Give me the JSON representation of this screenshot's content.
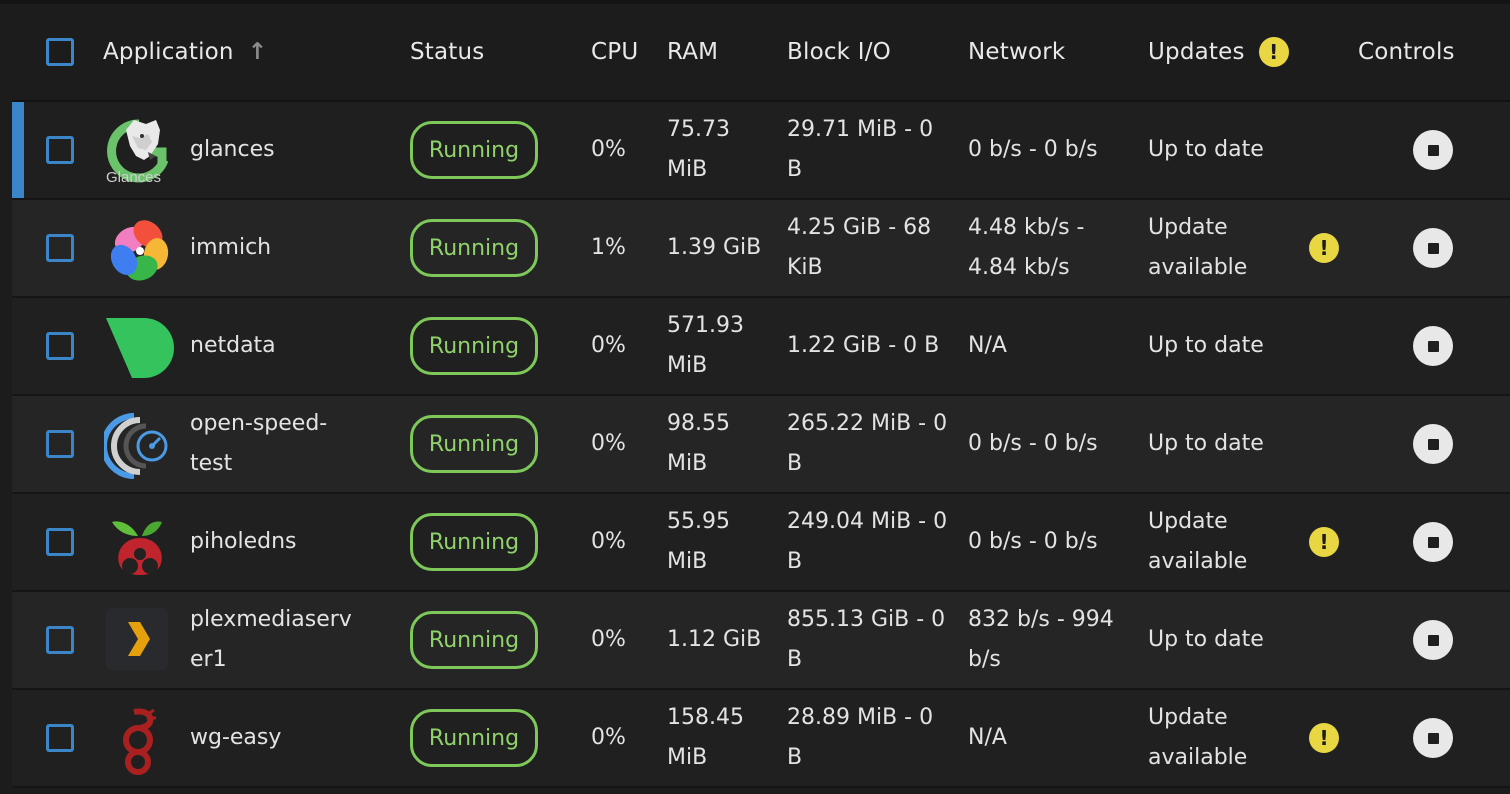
{
  "header": {
    "application": "Application",
    "sort_arrow": "↑",
    "status": "Status",
    "cpu": "CPU",
    "ram": "RAM",
    "block_io": "Block I/O",
    "network": "Network",
    "updates": "Updates",
    "updates_warn": "!",
    "controls": "Controls"
  },
  "colors": {
    "accent": "#3a86c8",
    "running": "#7ec85a",
    "warning": "#e8d642"
  },
  "rows": [
    {
      "name": "glances",
      "name_l1": "glances",
      "name_l2": "",
      "icon": "glances-icon",
      "logo_caption": "Glances",
      "status": "Running",
      "cpu": "0%",
      "ram_l1": "75.73",
      "ram_l2": "MiB",
      "bio_l1": "29.71 MiB - 0",
      "bio_l2": "B",
      "net_l1": "0 b/s - 0 b/s",
      "net_l2": "",
      "upd_l1": "Up to date",
      "upd_l2": "",
      "update_available": false
    },
    {
      "name": "immich",
      "name_l1": "immich",
      "name_l2": "",
      "icon": "immich-icon",
      "status": "Running",
      "cpu": "1%",
      "ram_l1": "1.39 GiB",
      "ram_l2": "",
      "bio_l1": "4.25 GiB - 68",
      "bio_l2": "KiB",
      "net_l1": "4.48 kb/s -",
      "net_l2": "4.84 kb/s",
      "upd_l1": "Update",
      "upd_l2": "available",
      "update_available": true
    },
    {
      "name": "netdata",
      "name_l1": "netdata",
      "name_l2": "",
      "icon": "netdata-icon",
      "status": "Running",
      "cpu": "0%",
      "ram_l1": "571.93",
      "ram_l2": "MiB",
      "bio_l1": "1.22 GiB - 0 B",
      "bio_l2": "",
      "net_l1": "N/A",
      "net_l2": "",
      "upd_l1": "Up to date",
      "upd_l2": "",
      "update_available": false
    },
    {
      "name": "open-speed-test",
      "name_l1": "open-speed-",
      "name_l2": "test",
      "icon": "speedtest-icon",
      "status": "Running",
      "cpu": "0%",
      "ram_l1": "98.55",
      "ram_l2": "MiB",
      "bio_l1": "265.22 MiB - 0",
      "bio_l2": "B",
      "net_l1": "0 b/s - 0 b/s",
      "net_l2": "",
      "upd_l1": "Up to date",
      "upd_l2": "",
      "update_available": false
    },
    {
      "name": "piholedns",
      "name_l1": "piholedns",
      "name_l2": "",
      "icon": "pihole-icon",
      "status": "Running",
      "cpu": "0%",
      "ram_l1": "55.95",
      "ram_l2": "MiB",
      "bio_l1": "249.04 MiB - 0",
      "bio_l2": "B",
      "net_l1": "0 b/s - 0 b/s",
      "net_l2": "",
      "upd_l1": "Update",
      "upd_l2": "available",
      "update_available": true
    },
    {
      "name": "plexmediaserver1",
      "name_l1": "plexmediaserv",
      "name_l2": "er1",
      "icon": "plex-icon",
      "status": "Running",
      "cpu": "0%",
      "ram_l1": "1.12 GiB",
      "ram_l2": "",
      "bio_l1": "855.13 GiB - 0",
      "bio_l2": "B",
      "net_l1": "832 b/s - 994",
      "net_l2": "b/s",
      "upd_l1": "Up to date",
      "upd_l2": "",
      "update_available": false
    },
    {
      "name": "wg-easy",
      "name_l1": "wg-easy",
      "name_l2": "",
      "icon": "wireguard-icon",
      "status": "Running",
      "cpu": "0%",
      "ram_l1": "158.45",
      "ram_l2": "MiB",
      "bio_l1": "28.89 MiB - 0",
      "bio_l2": "B",
      "net_l1": "N/A",
      "net_l2": "",
      "upd_l1": "Update",
      "upd_l2": "available",
      "update_available": true
    }
  ]
}
